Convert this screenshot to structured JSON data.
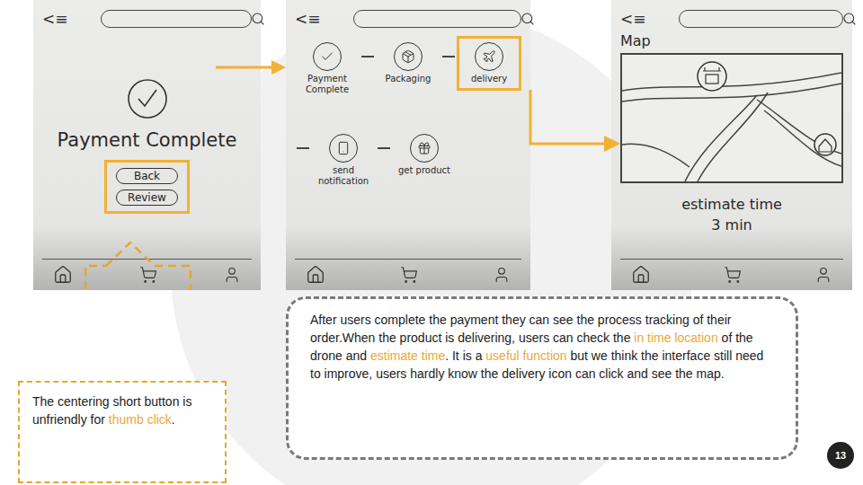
{
  "screens": [
    {
      "kind": "payment",
      "nav": "<≡",
      "title": "Payment Complete",
      "buttons": [
        "Back",
        "Review"
      ]
    },
    {
      "kind": "tracking",
      "nav": "<≡",
      "steps": [
        {
          "label": "Payment Complete",
          "selected": false
        },
        {
          "label": "Packaging",
          "selected": false
        },
        {
          "label": "delivery",
          "selected": true
        },
        {
          "label": "send notification",
          "selected": false
        },
        {
          "label": "get product",
          "selected": false
        }
      ]
    },
    {
      "kind": "map",
      "nav": "<≡",
      "title": "Map",
      "eta_label": "estimate time",
      "eta": "3 min"
    }
  ],
  "notes": [
    {
      "kind": "accent",
      "segments": [
        {
          "text": "The centering short button is unfriendly for ",
          "highlight": false
        },
        {
          "text": "thumb click",
          "highlight": true
        },
        {
          "text": ".",
          "highlight": false
        }
      ]
    },
    {
      "kind": "neutral",
      "segments": [
        {
          "text": "After users complete the payment they can see the process tracking of their order.When the product is delivering, users can check the ",
          "highlight": false
        },
        {
          "text": "in time location",
          "highlight": true
        },
        {
          "text": " of the drone and ",
          "highlight": false
        },
        {
          "text": "estimate time",
          "highlight": true
        },
        {
          "text": ". It is a ",
          "highlight": false
        },
        {
          "text": "useful function",
          "highlight": true
        },
        {
          "text": " but we think the interface still need to improve, users hardly know the delivery icon can click and see the map.",
          "highlight": false
        }
      ]
    }
  ],
  "page_number": "13"
}
